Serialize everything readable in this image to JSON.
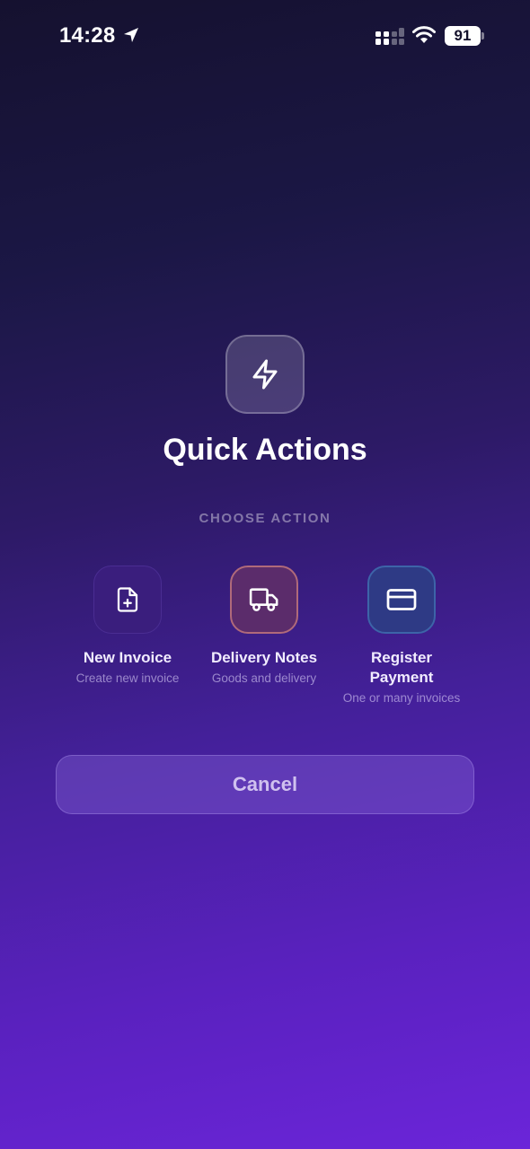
{
  "status_bar": {
    "time": "14:28",
    "battery": "91"
  },
  "header": {
    "title": "Quick Actions",
    "section_label": "CHOOSE ACTION"
  },
  "actions": [
    {
      "title": "New Invoice",
      "subtitle": "Create new invoice",
      "icon": "file-plus-icon"
    },
    {
      "title": "Delivery Notes",
      "subtitle": "Goods and delivery",
      "icon": "truck-icon"
    },
    {
      "title": "Register Payment",
      "subtitle": "One or many invoices",
      "icon": "credit-card-icon"
    }
  ],
  "cancel_label": "Cancel",
  "colors": {
    "background_top": "#15112f",
    "background_bottom": "#6b25d9",
    "new_invoice_tile": "#3a1e7d",
    "delivery_tile": "#5b2c6b",
    "payment_tile": "#2e3a85"
  }
}
